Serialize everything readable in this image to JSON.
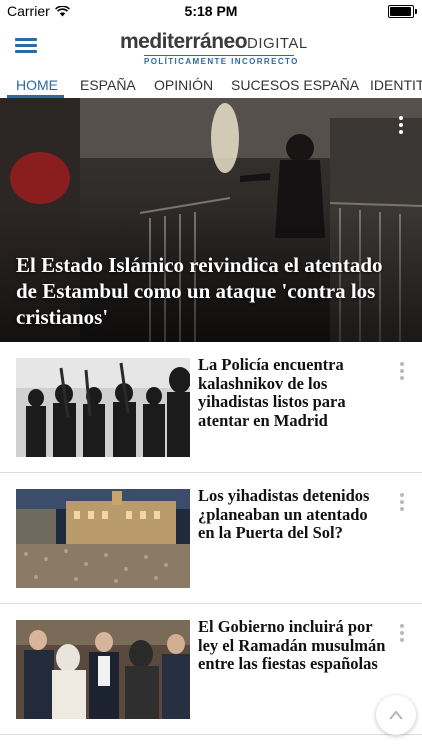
{
  "status_bar": {
    "carrier": "Carrier",
    "time": "5:18 PM"
  },
  "header": {
    "logo_main": "mediterráneo",
    "logo_suffix": "DIGITAL",
    "logo_tagline": "POLÍTICAMENTE INCORRECTO"
  },
  "tabs": [
    {
      "label": "HOME"
    },
    {
      "label": "ESPAÑA"
    },
    {
      "label": "OPINIÓN"
    },
    {
      "label": "SUCESOS ESPAÑA"
    },
    {
      "label": "IDENTITA"
    }
  ],
  "hero": {
    "title": "El Estado Islámico reivindica el atentado de Estambul como un ataque 'contra los cristianos'"
  },
  "articles": [
    {
      "title": "La Policía encuentra kalashnikov de los yihadistas listos para atentar en Madrid"
    },
    {
      "title": "Los yihadistas detenidos ¿planeaban un atentado en la Puerta del Sol?"
    },
    {
      "title": "El Gobierno incluirá por ley el Ramadán musulmán entre las fiestas españolas"
    }
  ],
  "colors": {
    "accent": "#2a6aa8",
    "logo_text": "#3b3b3b"
  },
  "icons": {
    "menu": "hamburger-menu-icon",
    "more": "more-vertical-icon",
    "scroll_top": "chevron-up-icon",
    "wifi": "wifi-icon",
    "battery": "battery-icon"
  }
}
